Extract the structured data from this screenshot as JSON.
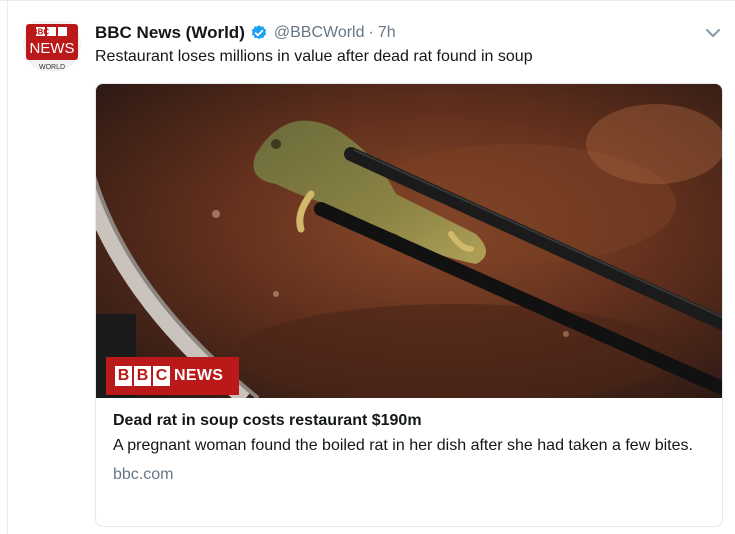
{
  "tweet": {
    "display_name": "BBC News (World)",
    "handle": "@BBCWorld",
    "separator": "·",
    "time": "7h",
    "text": "Restaurant loses millions in value after dead rat found in soup",
    "avatar": {
      "logo_top": "BBC",
      "logo_middle": "NEWS",
      "logo_bottom": "WORLD",
      "colors": {
        "red": "#bb1919",
        "white": "#ffffff"
      }
    },
    "verified_color": "#1da1f2"
  },
  "card": {
    "image_overlay": {
      "letters": [
        "B",
        "B",
        "C"
      ],
      "label": "NEWS",
      "color": "#bb1919"
    },
    "title": "Dead rat in soup costs restaurant $190m",
    "description": "A pregnant woman found the boiled rat in her dish after she had taken a few bites.",
    "domain": "bbc.com"
  }
}
